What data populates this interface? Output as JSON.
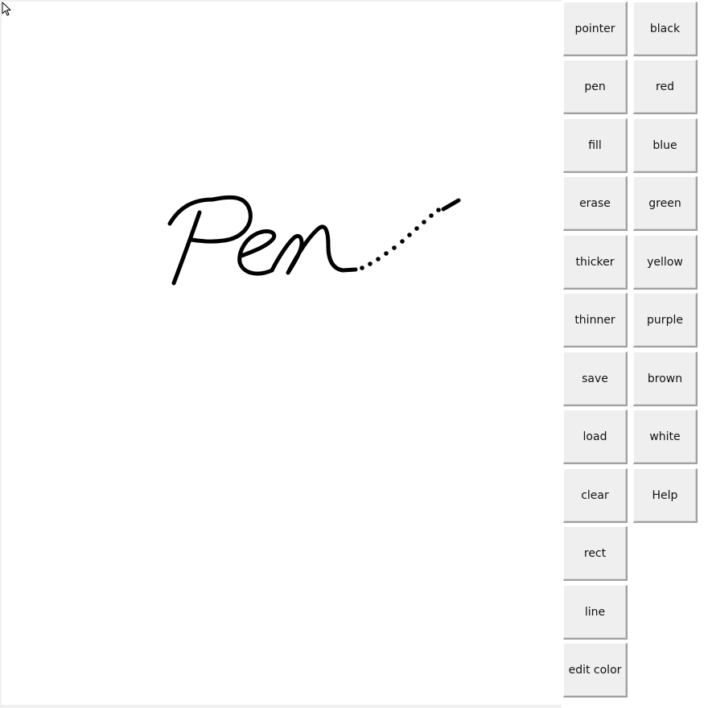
{
  "tools": [
    "pointer",
    "pen",
    "fill",
    "erase",
    "thicker",
    "thinner",
    "save",
    "load",
    "clear",
    "rect",
    "line",
    "edit color"
  ],
  "colors": [
    "black",
    "red",
    "blue",
    "green",
    "yellow",
    "purple",
    "brown",
    "white",
    "Help"
  ],
  "current_stroke_color": "#000000",
  "canvas_background": "#ffffff"
}
